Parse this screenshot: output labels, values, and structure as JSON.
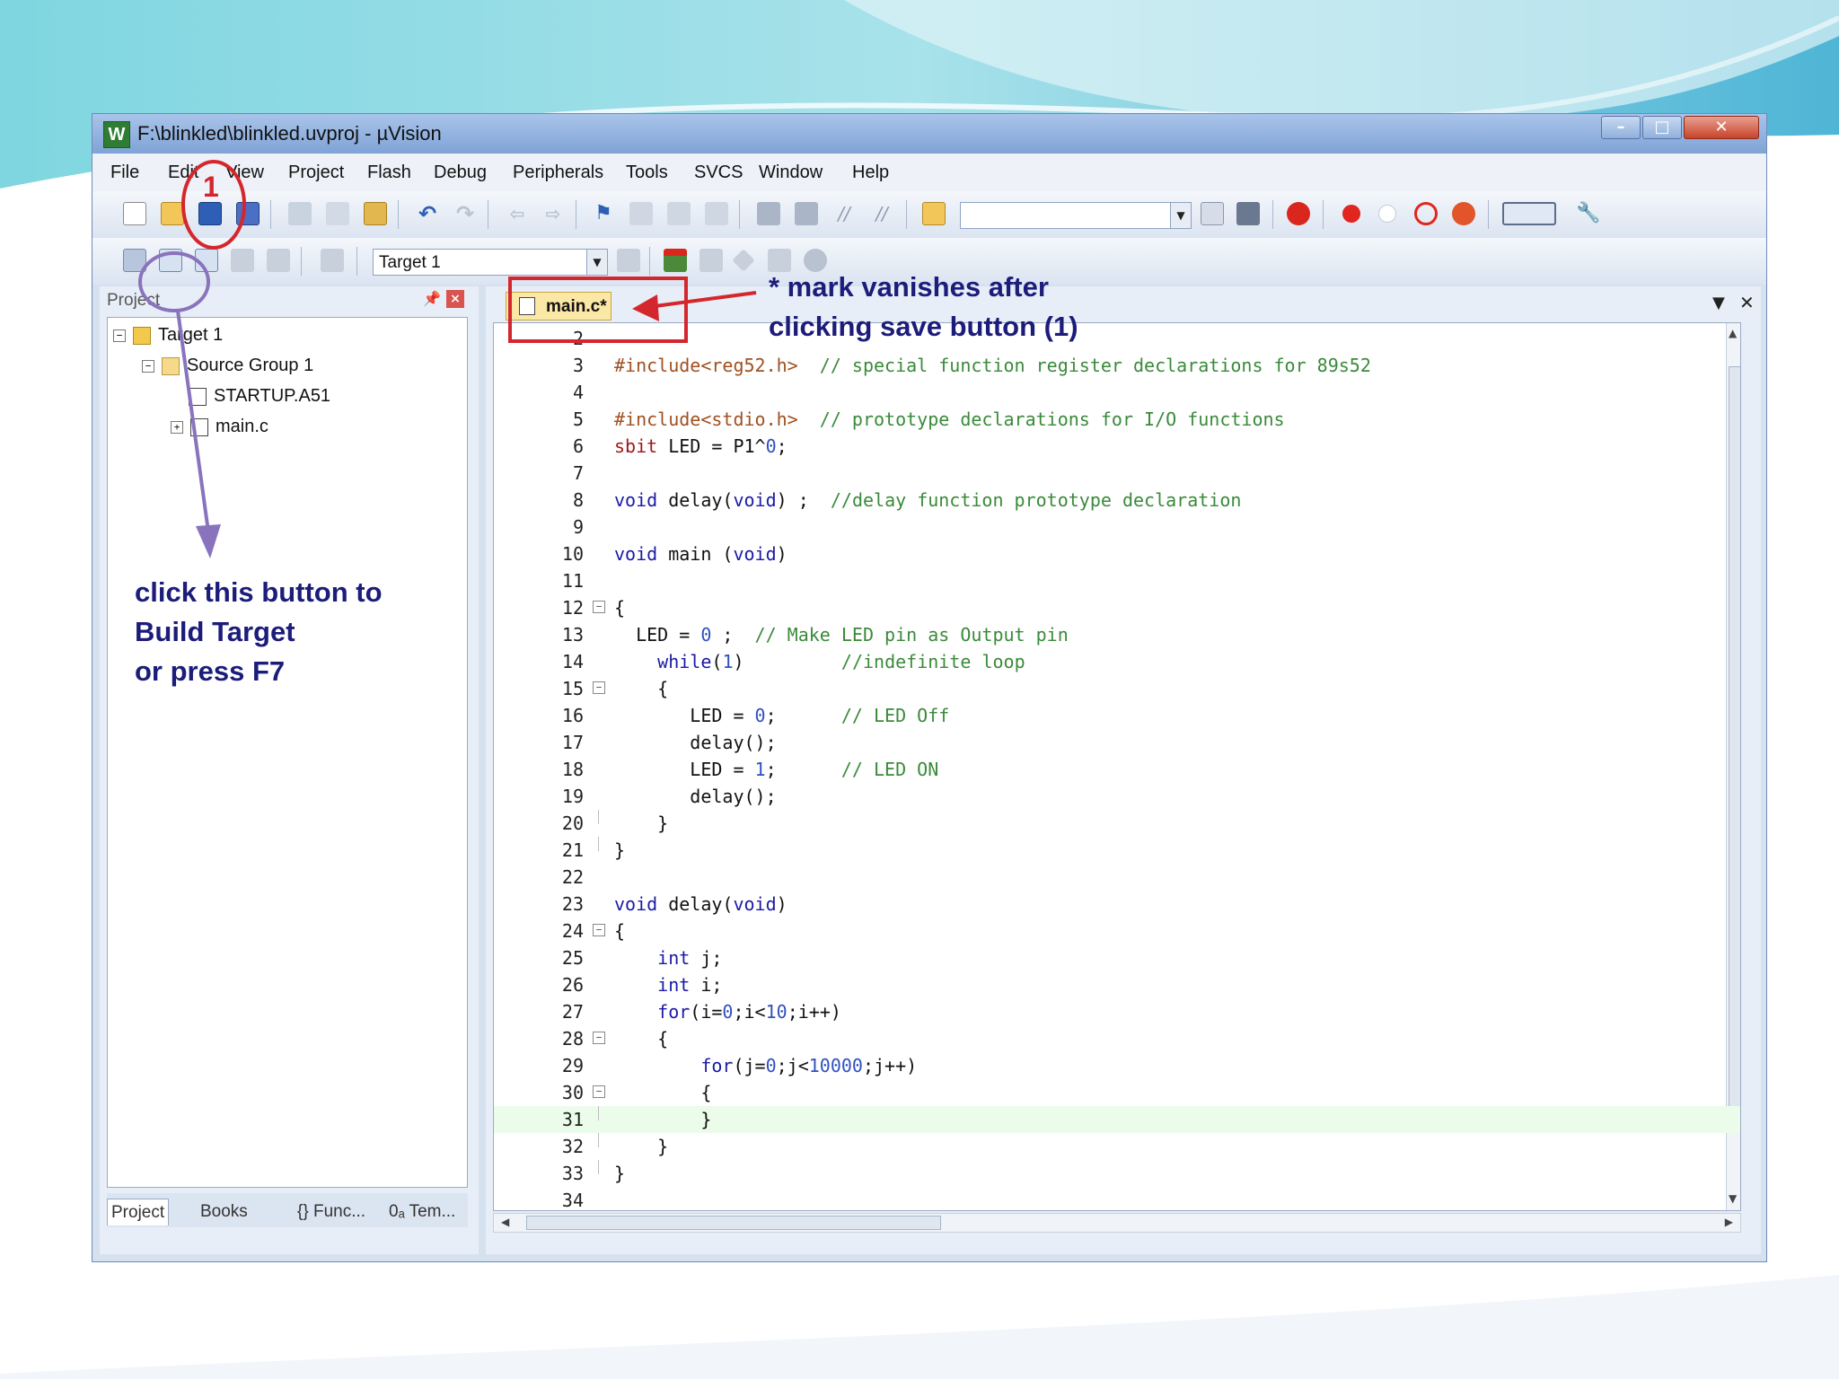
{
  "window": {
    "title": "F:\\blinkled\\blinkled.uvproj - µVision",
    "icon": "uvision-app-icon"
  },
  "menu": [
    "File",
    "Edit",
    "View",
    "Project",
    "Flash",
    "Debug",
    "Peripherals",
    "Tools",
    "SVCS",
    "Window",
    "Help"
  ],
  "build_toolbar": {
    "target_select": "Target 1"
  },
  "project_panel": {
    "title": "Project",
    "tree": {
      "root": "Target 1",
      "group": "Source Group 1",
      "files": [
        "STARTUP.A51",
        "main.c"
      ]
    },
    "tabs": [
      "Project",
      "Books",
      "{} Func...",
      "0ₐ Tem..."
    ]
  },
  "editor": {
    "tab_label": "main.c*",
    "highlighted_line": 31,
    "first_line": 2,
    "last_line": 34
  },
  "annotations": {
    "callout_number": "1",
    "save_note_line1": "* mark vanishes after",
    "save_note_line2": "clicking save button (1)",
    "build_note_line1": "click this button to",
    "build_note_line2": "Build Target",
    "build_note_line3": "or press F7"
  },
  "colors": {
    "keyword": "#1a1aa6",
    "comment": "#3a8a3a",
    "number": "#3050c0",
    "annotation_text": "#1c1c7a",
    "callout_red": "#d4272d",
    "arrow_purple": "#8a73bd",
    "highlight_line": "#ebfcea",
    "editor_tab": "#fbe7a6"
  }
}
